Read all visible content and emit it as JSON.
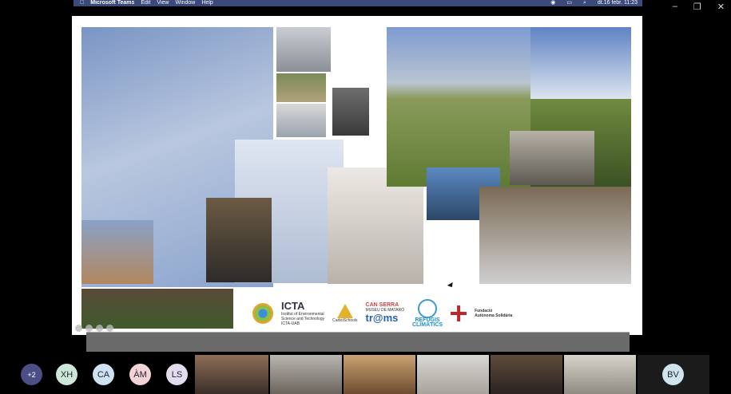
{
  "menubar": {
    "app": "Microsoft Teams",
    "items": [
      "Edit",
      "View",
      "Window",
      "Help"
    ],
    "clock": "dt.16 febr. 11:23"
  },
  "slide": {
    "logos": {
      "icta_name": "ICTA",
      "icta_line1": "Institut of Environmental",
      "icta_line2": "Science and Technology",
      "icta_line3": "ICTA-UAB",
      "carbo": "CarboSchools",
      "can_serra_1": "CAN SERRA",
      "can_serra_2": "MUSEU DE MATARÓ",
      "trams": "tr@ms",
      "refugis_1": "REFUGIS",
      "refugis_2": "CLIMÀTICS",
      "fundacio_1": "Fundació",
      "fundacio_2": "Autònoma Solidària"
    }
  },
  "participants": {
    "more": "+2",
    "initials": [
      "XH",
      "CA",
      "ÀM",
      "LS",
      "BV"
    ]
  }
}
